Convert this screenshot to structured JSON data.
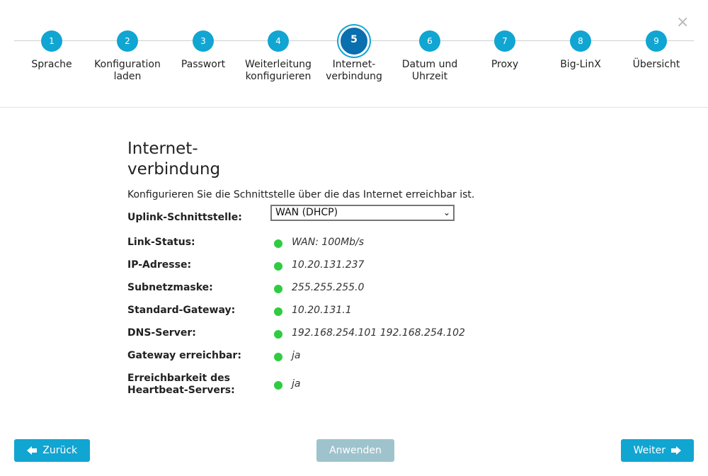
{
  "close_label": "×",
  "steps": [
    {
      "number": "1",
      "label": "Sprache"
    },
    {
      "number": "2",
      "label": "Konfiguration laden"
    },
    {
      "number": "3",
      "label": "Passwort"
    },
    {
      "number": "4",
      "label": "Weiterleitung konfigurieren"
    },
    {
      "number": "5",
      "label": "Internet-verbindung"
    },
    {
      "number": "6",
      "label": "Datum und Uhrzeit"
    },
    {
      "number": "7",
      "label": "Proxy"
    },
    {
      "number": "8",
      "label": "Big-LinX"
    },
    {
      "number": "9",
      "label": "Übersicht"
    }
  ],
  "active_step": 5,
  "page": {
    "title": "Internet-verbindung",
    "description": "Konfigurieren Sie die Schnittstelle über die das Internet erreichbar ist."
  },
  "form": {
    "uplink_label": "Uplink-Schnittstelle:",
    "uplink_value": "WAN (DHCP)",
    "status_rows": [
      {
        "label": "Link-Status:",
        "value": "WAN: 100Mb/s"
      },
      {
        "label": "IP-Adresse:",
        "value": "10.20.131.237"
      },
      {
        "label": "Subnetzmaske:",
        "value": "255.255.255.0"
      },
      {
        "label": "Standard-Gateway:",
        "value": "10.20.131.1"
      },
      {
        "label": "DNS-Server:",
        "value": "192.168.254.101 192.168.254.102"
      },
      {
        "label": "Gateway erreichbar:",
        "value": "ja"
      },
      {
        "label": "Erreichbarkeit des Heartbeat-Servers:",
        "value": "ja"
      }
    ]
  },
  "buttons": {
    "back": "Zurück",
    "apply": "Anwenden",
    "next": "Weiter"
  },
  "colors": {
    "accent": "#11a5d2",
    "active_step": "#0a6fae",
    "status_ok": "#2ecc40",
    "disabled": "#9ec3cd"
  }
}
